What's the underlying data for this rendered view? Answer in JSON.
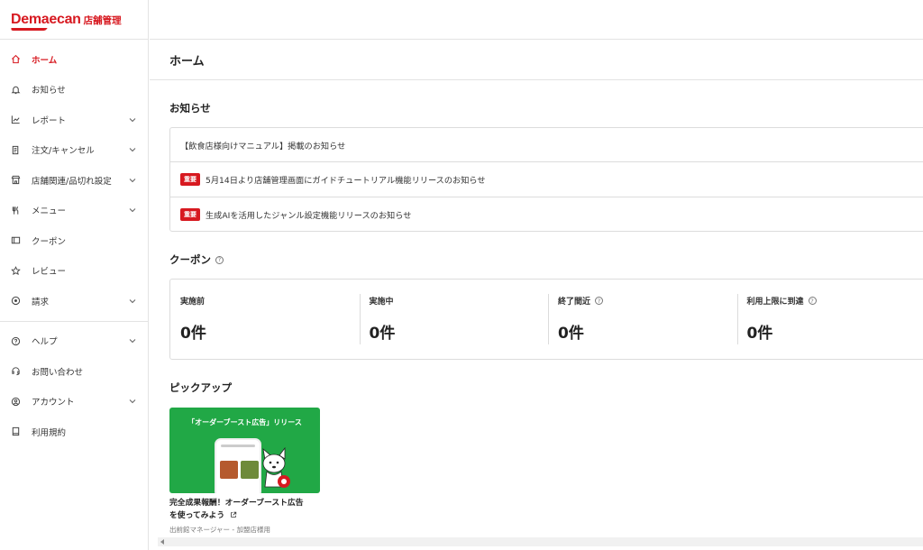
{
  "brand": {
    "name": "Demaecan",
    "sub": "店舗管理"
  },
  "sidebar": {
    "items": [
      {
        "label": "ホーム",
        "icon": "home-icon",
        "active": true,
        "expandable": false
      },
      {
        "label": "お知らせ",
        "icon": "bell-icon",
        "expandable": false
      },
      {
        "label": "レポート",
        "icon": "chart-icon",
        "expandable": true
      },
      {
        "label": "注文/キャンセル",
        "icon": "receipt-icon",
        "expandable": true
      },
      {
        "label": "店舗関連/品切れ設定",
        "icon": "store-icon",
        "expandable": true
      },
      {
        "label": "メニュー",
        "icon": "cutlery-icon",
        "expandable": true
      },
      {
        "label": "クーポン",
        "icon": "ticket-icon",
        "expandable": false
      },
      {
        "label": "レビュー",
        "icon": "star-icon",
        "expandable": false
      },
      {
        "label": "請求",
        "icon": "coin-icon",
        "expandable": true
      }
    ],
    "bottom_items": [
      {
        "label": "ヘルプ",
        "icon": "question-icon",
        "expandable": true
      },
      {
        "label": "お問い合わせ",
        "icon": "headset-icon",
        "expandable": false
      },
      {
        "label": "アカウント",
        "icon": "user-icon",
        "expandable": true
      },
      {
        "label": "利用規約",
        "icon": "book-icon",
        "expandable": false
      }
    ]
  },
  "page": {
    "title": "ホーム"
  },
  "news": {
    "title": "お知らせ",
    "items": [
      {
        "badge": "",
        "text": "【飲食店様向けマニュアル】掲載のお知らせ"
      },
      {
        "badge": "重要",
        "text": "5月14日より店舗管理画面にガイドチュートリアル機能リリースのお知らせ"
      },
      {
        "badge": "重要",
        "text": "生成AIを活用したジャンル設定機能リリースのお知らせ"
      }
    ]
  },
  "coupon": {
    "title": "クーポン",
    "help": "?",
    "stats": [
      {
        "label": "実施前",
        "value": "0件",
        "help": false
      },
      {
        "label": "実施中",
        "value": "0件",
        "help": false
      },
      {
        "label": "終了間近",
        "value": "0件",
        "help": true
      },
      {
        "label": "利用上限に到達",
        "value": "0件",
        "help": true
      }
    ]
  },
  "pickup": {
    "title": "ピックアップ",
    "card": {
      "banner": "「オーダーブースト広告」リリース",
      "caption_line1": "完全成果報酬！オーダーブースト広告",
      "caption_line2": "を使ってみよう",
      "source": "出前館マネージャー - 加盟店様用"
    }
  },
  "colors": {
    "accent": "#d71920",
    "banner": "#21a846"
  }
}
